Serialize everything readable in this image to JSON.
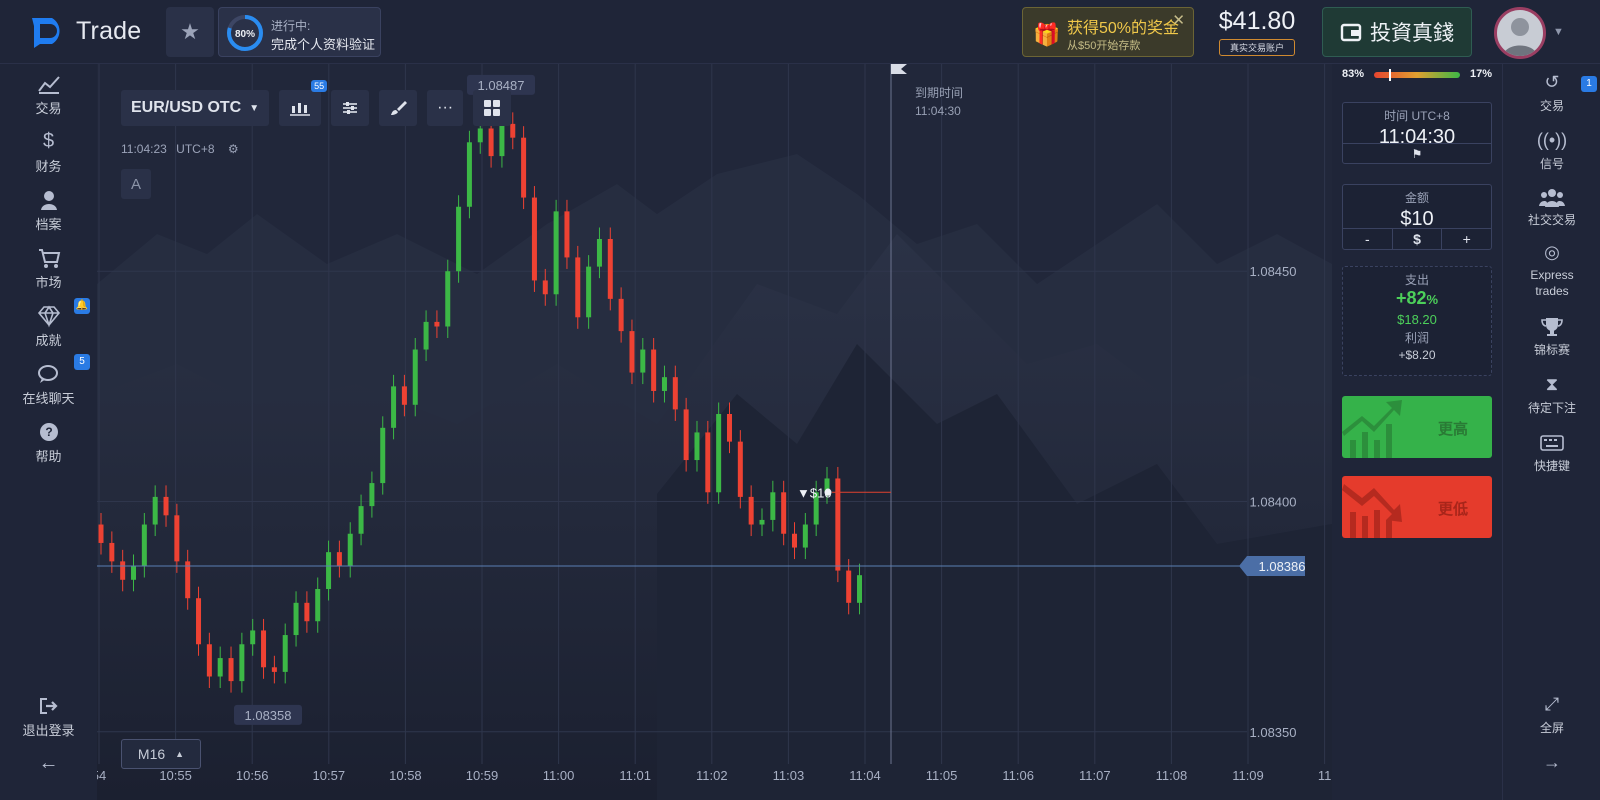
{
  "app": {
    "logo_text": "Trade"
  },
  "header": {
    "progress_percent": "80%",
    "progress_value": 0.8,
    "progress_title": "进行中:",
    "progress_sub": "完成个人资料验证",
    "bonus_title": "获得50%的奖金",
    "bonus_sub": "从$50开始存款",
    "balance": "$41.80",
    "balance_badge": "真实交易账户",
    "invest_label": "投資真錢"
  },
  "leftnav": {
    "items": [
      {
        "label": "交易",
        "icon": "chart-line-icon"
      },
      {
        "label": "财务",
        "icon": "dollar-icon"
      },
      {
        "label": "档案",
        "icon": "user-icon"
      },
      {
        "label": "市场",
        "icon": "cart-icon"
      },
      {
        "label": "成就",
        "icon": "diamond-icon"
      },
      {
        "label": "在线聊天",
        "icon": "chat-icon",
        "badge": "5"
      },
      {
        "label": "帮助",
        "icon": "help-icon"
      }
    ],
    "logout_label": "退出登录"
  },
  "chart": {
    "pair": "EUR/USD OTC",
    "indicator_badge": "55",
    "clock": "11:04:23",
    "timezone": "UTC+8",
    "a_label": "A",
    "expiry_label": "到期时间",
    "expiry_time": "11:04:30",
    "timeframe": "M16",
    "high_label": "1.08487",
    "low_label": "1.08358",
    "trade_marker": "$10",
    "current_price": "1.08386"
  },
  "chart_data": {
    "type": "candlestick",
    "title": "",
    "xlabel": "",
    "ylabel": "",
    "ylim": [
      1.08343,
      1.08495
    ],
    "y_ticks": [
      "1.08450",
      "1.08400",
      "1.08350"
    ],
    "x_ticks": [
      "54",
      "10:55",
      "10:56",
      "10:57",
      "10:58",
      "10:59",
      "11:00",
      "11:01",
      "11:02",
      "11:03",
      "11:04",
      "11:05",
      "11:06",
      "11:07",
      "11:08",
      "11:09",
      "11"
    ],
    "series": [
      {
        "values": [
          1.08391,
          1.08387,
          1.08383,
          1.08386,
          1.08395,
          1.08401,
          1.08397,
          1.08387,
          1.08379,
          1.08369,
          1.08362,
          1.08366,
          1.08361,
          1.08369,
          1.08372,
          1.08364,
          1.08363,
          1.08371,
          1.08378,
          1.08374,
          1.08381,
          1.08389,
          1.08386,
          1.08393,
          1.08399,
          1.08404,
          1.08416,
          1.08425,
          1.08421,
          1.08433,
          1.08439,
          1.08438,
          1.0845,
          1.08464,
          1.08478,
          1.08481,
          1.08475,
          1.08482,
          1.08479,
          1.08466,
          1.08448,
          1.08445,
          1.08463,
          1.08453,
          1.0844,
          1.08451,
          1.08457,
          1.08444,
          1.08437,
          1.08428,
          1.08433,
          1.08424,
          1.08427,
          1.0842,
          1.08409,
          1.08415,
          1.08402,
          1.08419,
          1.08413,
          1.08401,
          1.08395,
          1.08396,
          1.08402,
          1.08393,
          1.0839,
          1.08395,
          1.08402,
          1.08405,
          1.08385,
          1.08378,
          1.08384
        ]
      }
    ],
    "current_price": 1.08386,
    "high_label": 1.08487,
    "low_label": 1.08358
  },
  "rpanel": {
    "sentiment_left": "83%",
    "sentiment_right": "17%",
    "sentiment_value": 0.83,
    "time_label": "时间 UTC+8",
    "time_value": "11:04:30",
    "amount_label": "金额",
    "amount_value": "$10",
    "minus": "-",
    "dollar": "$",
    "plus": "+",
    "payout_label": "支出",
    "payout_percent": "+82",
    "payout_percent_sign": "%",
    "payout_amount": "$18.20",
    "profit_label": "利润",
    "profit_amount": "+$8.20",
    "higher_label": "更高",
    "lower_label": "更低"
  },
  "rightnav": {
    "items": [
      {
        "label": "交易",
        "icon": "history-icon",
        "badge": "1"
      },
      {
        "label": "信号",
        "icon": "signal-icon"
      },
      {
        "label": "社交交易",
        "icon": "social-icon"
      },
      {
        "label": "Express trades",
        "icon": "target-icon"
      },
      {
        "label": "锦标赛",
        "icon": "trophy-icon"
      },
      {
        "label": "待定下注",
        "icon": "hourglass-icon"
      },
      {
        "label": "快捷键",
        "icon": "keyboard-icon"
      }
    ],
    "fullscreen_label": "全屏"
  },
  "colors": {
    "up": "#3cb846",
    "down": "#ee4233",
    "accent": "#2a7be4",
    "bg": "#21273a"
  }
}
